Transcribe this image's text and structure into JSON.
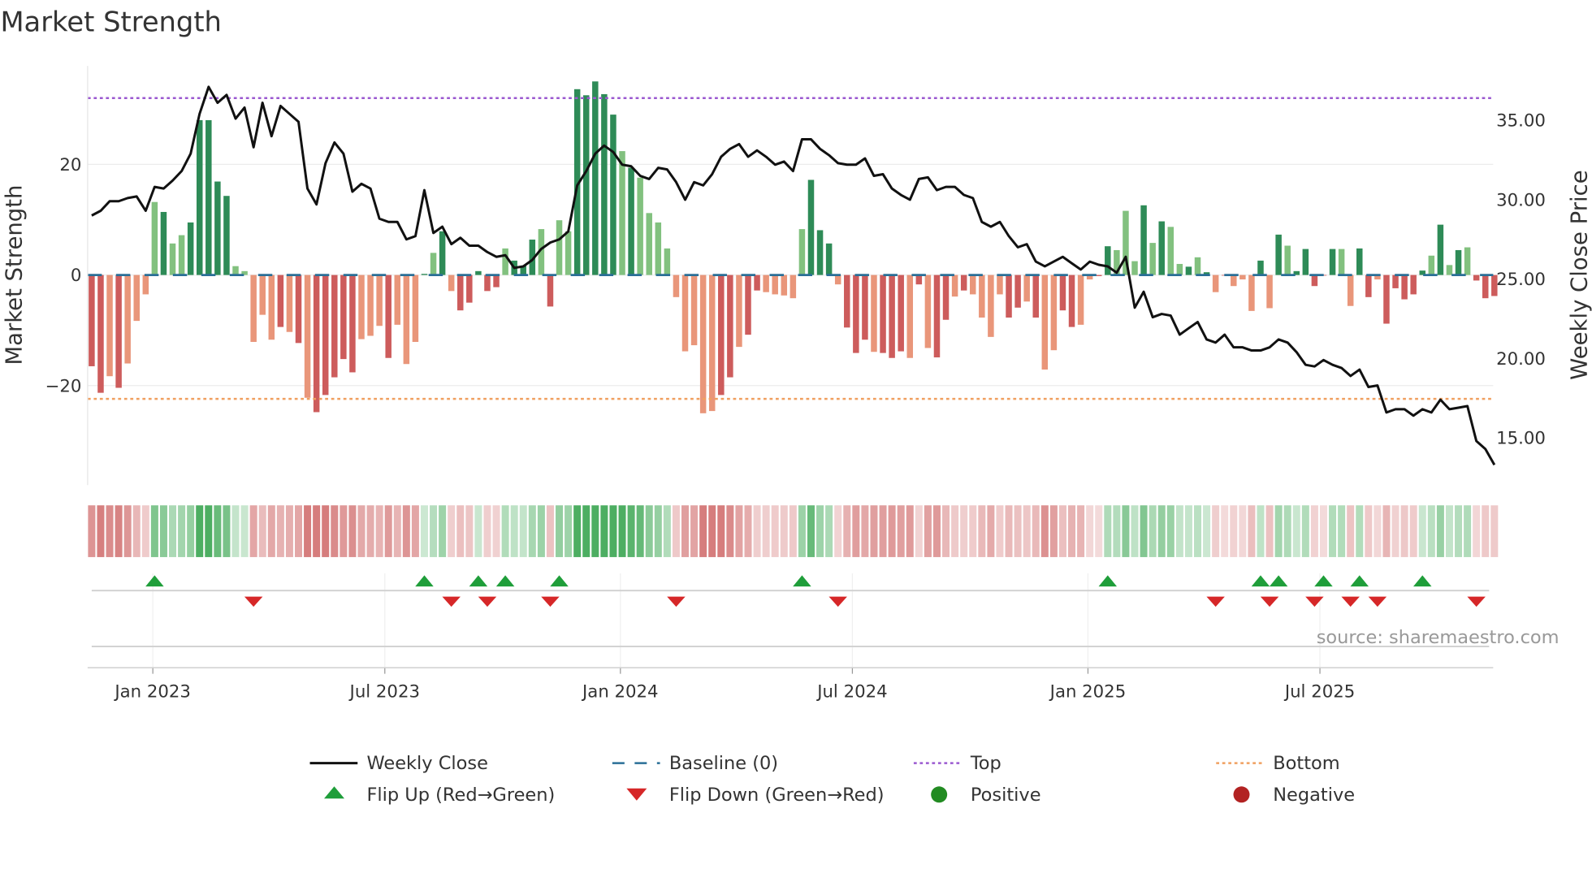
{
  "chart_data": {
    "type": "bar",
    "title": "Market Strength",
    "ylabel": "Market Strength",
    "y2label": "Weekly Close Price",
    "ylim": [
      -38,
      38
    ],
    "y2lim": [
      12.0,
      38.4
    ],
    "yticks": [
      {
        "v": 20,
        "label": "20"
      },
      {
        "v": 0,
        "label": "0"
      },
      {
        "v": -20,
        "label": "−20"
      }
    ],
    "y2ticks": [
      {
        "v": 35,
        "label": "35.00"
      },
      {
        "v": 30,
        "label": "30.00"
      },
      {
        "v": 25,
        "label": "25.00"
      },
      {
        "v": 20,
        "label": "20.00"
      },
      {
        "v": 15,
        "label": "15.00"
      }
    ],
    "xticks": [
      {
        "week": 6.8,
        "label": "Jan 2023"
      },
      {
        "week": 32.6,
        "label": "Jul 2023"
      },
      {
        "week": 58.8,
        "label": "Jan 2024"
      },
      {
        "week": 84.6,
        "label": "Jul 2024"
      },
      {
        "week": 110.8,
        "label": "Jan 2025"
      },
      {
        "week": 136.6,
        "label": "Jul 2025"
      }
    ],
    "top_level": 32,
    "bottom_level": -22.4,
    "strength": [
      -16.5,
      -21.3,
      -18.3,
      -20.4,
      -16,
      -8.3,
      -3.5,
      13.2,
      11.4,
      5.7,
      7.2,
      9.5,
      28,
      28,
      16.9,
      14.3,
      1.6,
      0.7,
      -12.1,
      -7.2,
      -11.7,
      -9.4,
      -10.3,
      -12.3,
      -22.2,
      -24.8,
      -21.7,
      -18.5,
      -15.2,
      -17.6,
      -11.6,
      -11,
      -9.2,
      -15,
      -9,
      -16.1,
      -12.1,
      0.2,
      4,
      7.9,
      -2.9,
      -6.4,
      -5,
      0.7,
      -2.9,
      -2.2,
      4.8,
      2.6,
      1.7,
      6.4,
      8.3,
      -5.7,
      9.9,
      7.9,
      33.6,
      32.5,
      35,
      32.7,
      29,
      22.4,
      19.4,
      17.6,
      11.2,
      9.5,
      4.8,
      -4,
      -13.8,
      -12.7,
      -25,
      -24.6,
      -21.7,
      -18.5,
      -13,
      -10.8,
      -2.8,
      -3.1,
      -3.5,
      -3.7,
      -4.2,
      8.3,
      17.2,
      8.1,
      5.7,
      -1.7,
      -9.5,
      -14.1,
      -11.7,
      -13.9,
      -14.1,
      -15,
      -13.8,
      -15,
      -1.7,
      -13.2,
      -14.9,
      -8.1,
      -3.9,
      -2.8,
      -3.5,
      -7.7,
      -11.2,
      -3.5,
      -7.7,
      -5.9,
      -4.8,
      -7.7,
      -17.1,
      -13.6,
      -6.4,
      -9.4,
      -9,
      -0.8,
      -0.2,
      5.2,
      4.5,
      11.6,
      2.5,
      12.6,
      5.8,
      9.7,
      8.7,
      2,
      1.5,
      3.2,
      0.5,
      -3.1,
      -0.1,
      -2,
      -0.8,
      -6.5,
      2.6,
      -6,
      7.3,
      5.3,
      0.7,
      4.7,
      -2,
      -0.1,
      4.7,
      4.7,
      -5.6,
      4.8,
      -4,
      -0.8,
      -8.8,
      -2.4,
      -4.4,
      -3.5,
      0.8,
      3.5,
      9.1,
      1.8,
      4.5,
      5,
      -1,
      -4.2,
      -3.8
    ],
    "strong": "ddldlllldlldddddllllldldldddddllldllldldldddddldddldlldddddldlllllllllddlddllllldddldddldddldlddldllllddldllddllddllldldlldldldllldldldddddllddldddddldldldddlddddl",
    "weekly_close": [
      29.0,
      29.3,
      29.9,
      29.9,
      30.1,
      30.2,
      29.3,
      30.8,
      30.7,
      31.2,
      31.8,
      32.9,
      35.4,
      37.1,
      36.1,
      36.6,
      35.1,
      35.8,
      33.3,
      36.1,
      34.0,
      35.9,
      35.4,
      34.9,
      30.7,
      29.7,
      32.3,
      33.6,
      32.9,
      30.5,
      31.0,
      30.7,
      28.8,
      28.6,
      28.6,
      27.5,
      27.7,
      30.6,
      27.9,
      28.3,
      27.2,
      27.6,
      27.1,
      27.1,
      26.7,
      26.4,
      26.5,
      25.7,
      25.8,
      26.2,
      26.9,
      27.3,
      27.5,
      28.0,
      30.9,
      31.8,
      32.9,
      33.4,
      33.0,
      32.2,
      32.1,
      31.5,
      31.3,
      32.0,
      31.9,
      31.1,
      30.0,
      31.1,
      30.9,
      31.6,
      32.7,
      33.2,
      33.5,
      32.7,
      33.1,
      32.7,
      32.2,
      32.4,
      31.8,
      33.8,
      33.8,
      33.2,
      32.8,
      32.3,
      32.2,
      32.2,
      32.6,
      31.5,
      31.6,
      30.7,
      30.3,
      30.0,
      31.3,
      31.4,
      30.6,
      30.8,
      30.8,
      30.3,
      30.1,
      28.6,
      28.3,
      28.6,
      27.7,
      27.0,
      27.2,
      26.1,
      25.8,
      26.1,
      26.4,
      26.0,
      25.6,
      26.1,
      25.9,
      25.8,
      25.4,
      26.4,
      23.2,
      24.2,
      22.6,
      22.8,
      22.7,
      21.5,
      21.9,
      22.3,
      21.2,
      21.0,
      21.5,
      20.7,
      20.7,
      20.5,
      20.5,
      20.7,
      21.2,
      21.0,
      20.4,
      19.6,
      19.5,
      19.9,
      19.6,
      19.4,
      18.9,
      19.3,
      18.2,
      18.3,
      16.6,
      16.8,
      16.8,
      16.4,
      16.8,
      16.6,
      17.4,
      16.8,
      16.9,
      17.0,
      14.8,
      14.3,
      13.3
    ],
    "flip_up_weeks": [
      7,
      37,
      43,
      46,
      52,
      79,
      113,
      130,
      132,
      137,
      141,
      148
    ],
    "flip_down_weeks": [
      18,
      40,
      44,
      51,
      65,
      83,
      125,
      131,
      136,
      140,
      143,
      154
    ],
    "legend": [
      {
        "label": "Weekly Close",
        "kind": "line"
      },
      {
        "label": "Baseline (0)",
        "kind": "dash"
      },
      {
        "label": "Top",
        "kind": "dotted-purple"
      },
      {
        "label": "Bottom",
        "kind": "dotted-orange"
      },
      {
        "label": "Flip Up (Red→Green)",
        "kind": "triangle-up"
      },
      {
        "label": "Flip Down (Green→Red)",
        "kind": "triangle-down"
      },
      {
        "label": "Positive",
        "kind": "circle-green"
      },
      {
        "label": "Negative",
        "kind": "circle-red"
      }
    ],
    "legend_placement": "bottom"
  },
  "source": "source: sharemaestro.com",
  "colors": {
    "green_strong": "#2e8b57",
    "green_weak": "#82c17f",
    "red_strong": "#cd5c5c",
    "red_weak": "#e9967a",
    "baseline": "#2a6f97",
    "top": "#9b59d0",
    "bottom": "#f0a060",
    "flip_up": "#1f9e3a",
    "flip_down": "#d62728",
    "positive": "#228b22",
    "negative": "#b22222"
  }
}
